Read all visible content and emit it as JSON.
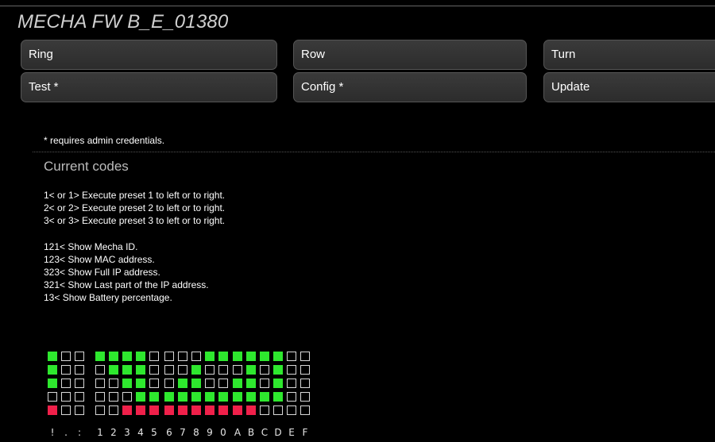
{
  "header": {
    "title": "MECHA FW B_E_01380"
  },
  "buttons": {
    "ring": "Ring",
    "row": "Row",
    "turn": "Turn",
    "test": "Test *",
    "config": "Config *",
    "update": "Update"
  },
  "main": {
    "note": "* requires admin credentials.",
    "heading": "Current codes",
    "codes": [
      "1< or 1> Execute preset 1 to left or to right.",
      "2< or 2> Execute preset 2 to left or to right.",
      "3< or 3> Execute preset 3 to left or to right.",
      "121< Show Mecha ID.",
      "123< Show MAC address.",
      "323< Show Full IP address.",
      "321< Show Last part of the IP address.",
      "13< Show Battery percentage."
    ]
  },
  "display": {
    "labels": [
      "!",
      ".",
      ":",
      "1",
      "2",
      "3",
      "4",
      "5",
      "6",
      "7",
      "8",
      "9",
      "0",
      "A",
      "B",
      "C",
      "D",
      "E",
      "F"
    ],
    "rows": [
      "gwwggggwwwwgggggg",
      "gwwwgggwwwgwwwgwg",
      "gwwwwggwwggwwggwg",
      "wwwwwwggggggggggg",
      "rwwwwrrrrrrrrrrww"
    ],
    "colors": {
      "on": "#2ee82e",
      "alert": "#f0204a",
      "off": "#000000"
    }
  }
}
